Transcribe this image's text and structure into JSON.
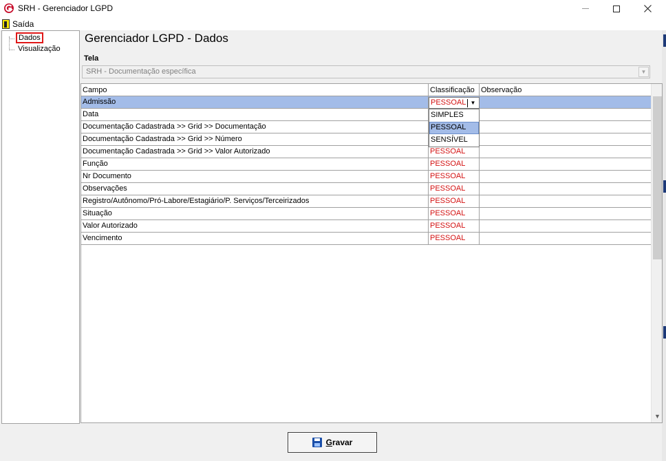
{
  "window": {
    "title": "SRH - Gerenciador LGPD"
  },
  "menu": {
    "exit_label": "Saída"
  },
  "tree": {
    "items": [
      "Dados",
      "Visualização"
    ],
    "selected": 0
  },
  "page": {
    "title": "Gerenciador LGPD - Dados"
  },
  "tela": {
    "label": "Tela",
    "value": "SRH - Documentação específica"
  },
  "grid": {
    "columns": [
      "Campo",
      "Classificação",
      "Observação"
    ],
    "rows": [
      {
        "campo": "Admissão",
        "classificacao": "PESSOAL",
        "observacao": ""
      },
      {
        "campo": "Data",
        "classificacao": "",
        "observacao": ""
      },
      {
        "campo": "Documentação Cadastrada >> Grid >> Documentação",
        "classificacao": "",
        "observacao": ""
      },
      {
        "campo": "Documentação Cadastrada >> Grid >> Número",
        "classificacao": "",
        "observacao": ""
      },
      {
        "campo": "Documentação Cadastrada >> Grid >> Valor Autorizado",
        "classificacao": "PESSOAL",
        "observacao": ""
      },
      {
        "campo": "Função",
        "classificacao": "PESSOAL",
        "observacao": ""
      },
      {
        "campo": "Nr Documento",
        "classificacao": "PESSOAL",
        "observacao": ""
      },
      {
        "campo": "Observações",
        "classificacao": "PESSOAL",
        "observacao": ""
      },
      {
        "campo": "Registro/Autônomo/Pró-Labore/Estagiário/P. Serviços/Terceirizados",
        "classificacao": "PESSOAL",
        "observacao": ""
      },
      {
        "campo": "Situação",
        "classificacao": "PESSOAL",
        "observacao": ""
      },
      {
        "campo": "Valor Autorizado",
        "classificacao": "PESSOAL",
        "observacao": ""
      },
      {
        "campo": "Vencimento",
        "classificacao": "PESSOAL",
        "observacao": ""
      }
    ],
    "active_row": 0,
    "editor": {
      "value": "PESSOAL"
    },
    "dropdown_options": [
      "SIMPLES",
      "PESSOAL",
      "SENSÍVEL"
    ],
    "dropdown_highlighted": 1
  },
  "actions": {
    "save_label_prefix": "G",
    "save_label_rest": "ravar"
  },
  "colors": {
    "selection": "#a3bce8",
    "classification_text": "#d41111",
    "highlight_box": "#e01818",
    "save_icon": "#1a4ea8"
  }
}
